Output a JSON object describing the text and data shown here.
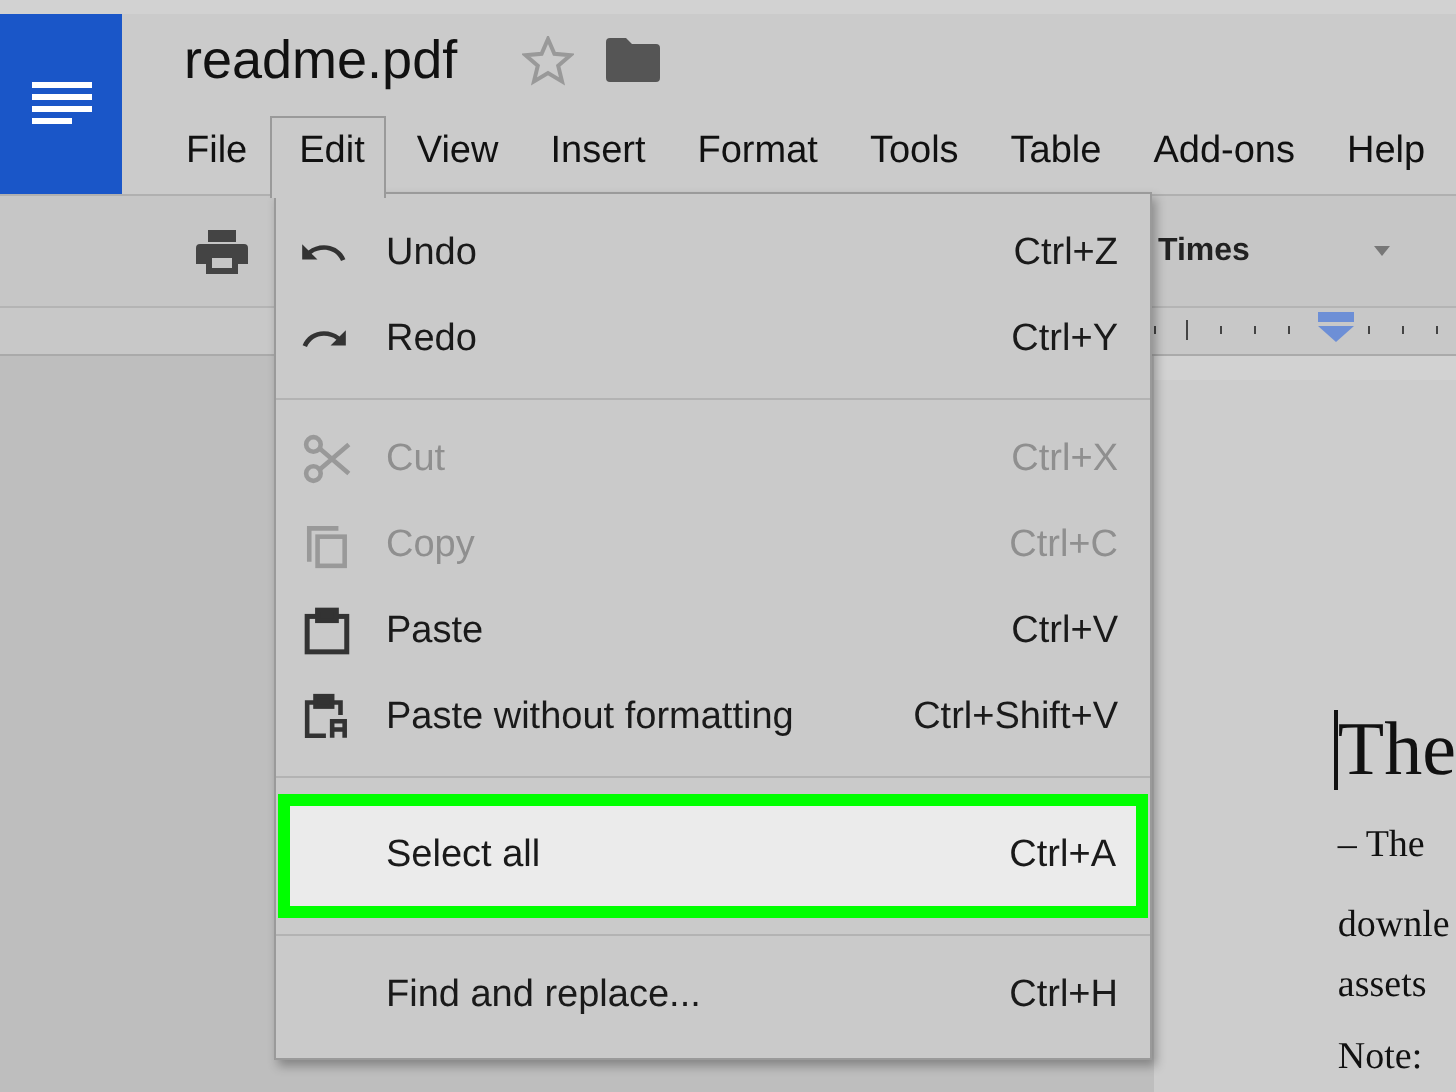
{
  "document": {
    "title": "readme.pdf"
  },
  "menu_bar": [
    {
      "label": "File",
      "selected": false
    },
    {
      "label": "Edit",
      "selected": true
    },
    {
      "label": "View",
      "selected": false
    },
    {
      "label": "Insert",
      "selected": false
    },
    {
      "label": "Format",
      "selected": false
    },
    {
      "label": "Tools",
      "selected": false
    },
    {
      "label": "Table",
      "selected": false
    },
    {
      "label": "Add-ons",
      "selected": false
    },
    {
      "label": "Help",
      "selected": false
    }
  ],
  "toolbar": {
    "font": "Times"
  },
  "edit_menu": [
    {
      "kind": "item",
      "label": "Undo",
      "shortcut": "Ctrl+Z",
      "disabled": false,
      "selected": false
    },
    {
      "kind": "item",
      "label": "Redo",
      "shortcut": "Ctrl+Y",
      "disabled": false,
      "selected": false
    },
    {
      "kind": "separator"
    },
    {
      "kind": "item",
      "label": "Cut",
      "shortcut": "Ctrl+X",
      "disabled": true,
      "selected": false
    },
    {
      "kind": "item",
      "label": "Copy",
      "shortcut": "Ctrl+C",
      "disabled": true,
      "selected": false
    },
    {
      "kind": "item",
      "label": "Paste",
      "shortcut": "Ctrl+V",
      "disabled": false,
      "selected": false
    },
    {
      "kind": "item",
      "label": "Paste without formatting",
      "shortcut": "Ctrl+Shift+V",
      "disabled": false,
      "selected": false
    },
    {
      "kind": "separator"
    },
    {
      "kind": "item",
      "label": "Select all",
      "shortcut": "Ctrl+A",
      "disabled": false,
      "selected": true
    },
    {
      "kind": "separator"
    },
    {
      "kind": "item",
      "label": "Find and replace...",
      "shortcut": "Ctrl+H",
      "disabled": false,
      "selected": false
    }
  ],
  "page_text": [
    {
      "kind": "heading",
      "text": "The"
    },
    {
      "kind": "line",
      "text": "– The"
    },
    {
      "kind": "line",
      "text": "downle"
    },
    {
      "kind": "line",
      "text": "assets"
    },
    {
      "kind": "line",
      "text": "Note:"
    }
  ]
}
